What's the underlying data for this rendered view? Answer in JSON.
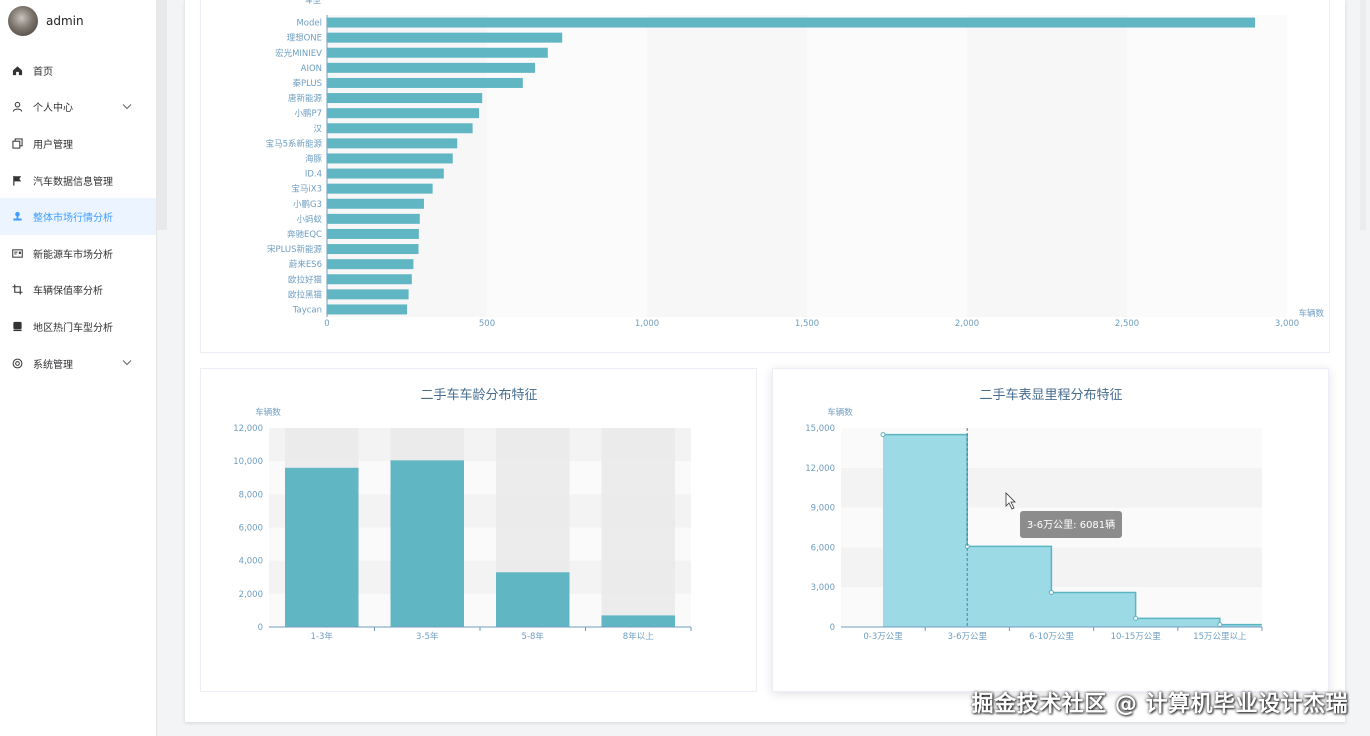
{
  "user": {
    "name": "admin"
  },
  "menu": [
    {
      "label": "首页",
      "icon": "home-icon"
    },
    {
      "label": "个人中心",
      "icon": "user-icon",
      "expandable": true
    },
    {
      "label": "用户管理",
      "icon": "copy-icon"
    },
    {
      "label": "汽车数据信息管理",
      "icon": "flag-icon"
    },
    {
      "label": "整体市场行情分析",
      "icon": "stamp-icon",
      "active": true
    },
    {
      "label": "新能源车市场分析",
      "icon": "postcard-icon"
    },
    {
      "label": "车辆保值率分析",
      "icon": "crop-icon"
    },
    {
      "label": "地区热门车型分析",
      "icon": "receipt-icon"
    },
    {
      "label": "系统管理",
      "icon": "gear-icon",
      "expandable": true
    }
  ],
  "colors": {
    "bar": "#61b6c4",
    "area": "#97d9e5",
    "axis": "#6e9ec2",
    "title": "#466c90",
    "active": "#409eff"
  },
  "watermark": "掘金技术社区 @ 计算机毕业设计杰瑞",
  "charts": {
    "models": {
      "ylabel_partial": "车型",
      "xlabel": "车辆数",
      "type": "bar",
      "orientation": "horizontal",
      "categories": [
        "Model",
        "理想ONE",
        "宏光MINIEV",
        "AION",
        "秦PLUS",
        "唐新能源",
        "小鹏P7",
        "汉",
        "宝马5系新能源",
        "海豚",
        "ID.4",
        "宝马iX3",
        "小鹏G3",
        "小蚂蚁",
        "奔驰EQC",
        "宋PLUS新能源",
        "蔚来ES6",
        "欧拉好猫",
        "欧拉黑猫",
        "Taycan"
      ],
      "values": [
        2900,
        735,
        690,
        650,
        612,
        485,
        475,
        455,
        407,
        393,
        365,
        330,
        303,
        290,
        287,
        286,
        270,
        265,
        255,
        250
      ],
      "xticks": [
        "0",
        "500",
        "1,000",
        "1,500",
        "2,000",
        "2,500",
        "3,000"
      ],
      "xlim": [
        0,
        3000
      ]
    },
    "age": {
      "title": "二手车车龄分布特征",
      "ylabel": "车辆数",
      "type": "bar",
      "categories": [
        "1-3年",
        "3-5年",
        "5-8年",
        "8年以上"
      ],
      "values": [
        9600,
        10050,
        3300,
        700
      ],
      "yticks": [
        "0",
        "2,000",
        "4,000",
        "6,000",
        "8,000",
        "10,000",
        "12,000"
      ],
      "ylim": [
        0,
        12000
      ]
    },
    "mileage": {
      "title": "二手车表显里程分布特征",
      "ylabel": "车辆数",
      "type": "area",
      "step": true,
      "categories": [
        "0-3万公里",
        "3-6万公里",
        "6-10万公里",
        "10-15万公里",
        "15万公里以上"
      ],
      "values": [
        14500,
        6081,
        2600,
        650,
        180
      ],
      "yticks": [
        "0",
        "3,000",
        "6,000",
        "9,000",
        "12,000",
        "15,000"
      ],
      "ylim": [
        0,
        15000
      ],
      "tooltip": "3-6万公里: 6081辆"
    }
  }
}
